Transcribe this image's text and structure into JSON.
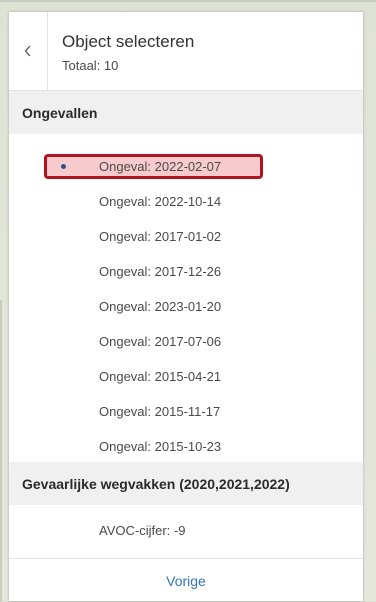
{
  "header": {
    "title": "Object selecteren",
    "subtitle": "Totaal: 10"
  },
  "groups": [
    {
      "name": "Ongevallen",
      "items": [
        "Ongeval: 2022-02-07",
        "Ongeval: 2022-10-14",
        "Ongeval: 2017-01-02",
        "Ongeval: 2017-12-26",
        "Ongeval: 2023-01-20",
        "Ongeval: 2017-07-06",
        "Ongeval: 2015-04-21",
        "Ongeval: 2015-11-17",
        "Ongeval: 2015-10-23"
      ]
    },
    {
      "name": "Gevaarlijke wegvakken (2020,2021,2022)",
      "items": [
        "AVOC-cijfer: -9"
      ]
    }
  ],
  "selected_item": "Ongeval: 2022-02-07",
  "footer": {
    "previous_label": "Vorige"
  },
  "colors": {
    "highlight_border": "#b0151d",
    "link": "#2f77b8",
    "selected_dot": "#2d4f8f"
  }
}
